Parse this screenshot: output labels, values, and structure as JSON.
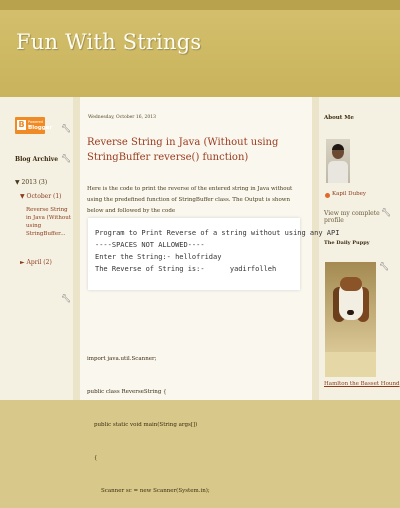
{
  "header": {
    "title": "Fun With Strings"
  },
  "left_sidebar": {
    "badge": {
      "small_text": "Powered by",
      "brand": "Blogger"
    },
    "archive": {
      "title": "Blog Archive",
      "year": "▼ 2013 (3)",
      "month": "▼ October (1)",
      "post": "Reverse String in Java (Without using StringBuffer...",
      "other_month": "► April (2)"
    }
  },
  "post": {
    "date": "Wednesday, October 16, 2013",
    "title": "Reverse String in Java (Without using StringBuffer reverse() function)",
    "intro": "Here is the code to print the reverse of the entered string in Java without using the predefined function of StringBuffer class. The Output is shown below and followed by the code",
    "output_lines": [
      "Program to Print Reverse of a string without using any API",
      "----SPACES NOT ALLOWED----",
      "Enter the String:- hellofriday",
      "The Reverse of String is:-      yadirfolleh"
    ],
    "code_lines": [
      "import java.util.Scanner;",
      "public class ReverseString {",
      "    public static void main(String args[])",
      "    {",
      "        Scanner sc = new Scanner(System.in);"
    ]
  },
  "right_sidebar": {
    "about_title": "About Me",
    "author_name": "Kapil Dubey",
    "profile_link": "View my complete profile",
    "puppy_title": "The Daily Puppy",
    "puppy_caption": "Hamlton the Basset Hound"
  },
  "icons": {
    "blogger": "blogger-logo-icon",
    "wrench": "wrench-icon",
    "blogger_profile": "blogger-profile-icon"
  },
  "colors": {
    "header": "#cbb560",
    "title_text": "#fffdf2",
    "link": "#8b3a1a",
    "post_title": "#9b3a1d",
    "background": "#f3efdf"
  }
}
